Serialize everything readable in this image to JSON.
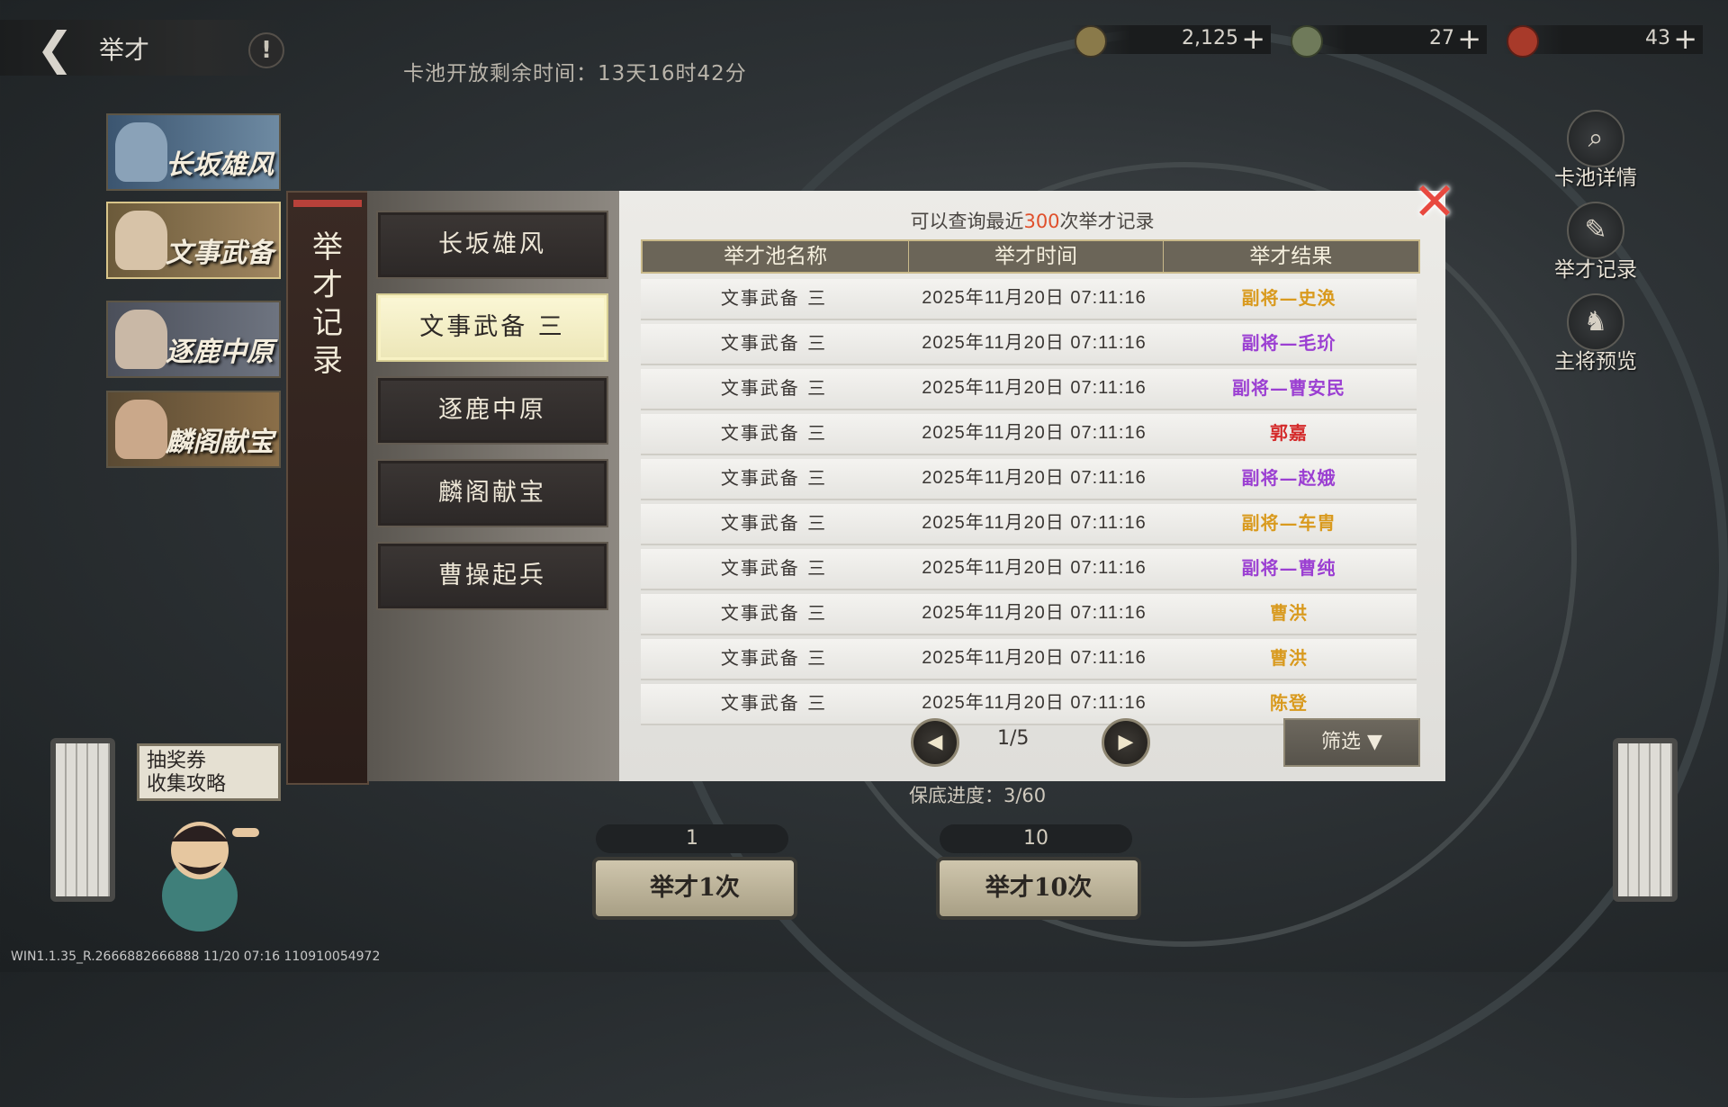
{
  "header": {
    "back_title": "举才",
    "info_label": "!",
    "pool_timer": "卡池开放剩余时间：13天16时42分"
  },
  "resources": [
    {
      "icon": "copper-coin-icon",
      "value": "2,125",
      "plus": "+",
      "color": "#8a7a4a"
    },
    {
      "icon": "jade-token-icon",
      "value": "27",
      "plus": "+",
      "color": "#6f7a5a"
    },
    {
      "icon": "red-gem-icon",
      "value": "43",
      "plus": "+",
      "color": "#a83a2a"
    }
  ],
  "banners": [
    {
      "label": "长坂雄风",
      "bg": "#3b5570",
      "face": "#8aa2b8"
    },
    {
      "label": "文事武备",
      "bg": "#6b5a3a",
      "face": "#d7c3a8"
    },
    {
      "label": "逐鹿中原",
      "bg": "#4b4f5a",
      "face": "#c9b8a6"
    },
    {
      "label": "麟阁献宝",
      "bg": "#5a4a33",
      "face": "#caa88a"
    }
  ],
  "side_menu": [
    {
      "label": "卡池详情",
      "icon": "magnifier-icon",
      "glyph": "⌕"
    },
    {
      "label": "举才记录",
      "icon": "brush-icon",
      "glyph": "✎"
    },
    {
      "label": "主将预览",
      "icon": "general-preview-icon",
      "glyph": "♞"
    }
  ],
  "guide": {
    "line1": "抽奖券",
    "line2": "收集攻略"
  },
  "modal": {
    "tab_label": "举才记录",
    "pools": [
      "长坂雄风",
      "文事武备 三",
      "逐鹿中原",
      "麟阁献宝",
      "曹操起兵"
    ],
    "active_pool_index": 1,
    "notice_prefix": "可以查询最近",
    "notice_count": "300",
    "notice_suffix": "次举才记录",
    "columns": [
      "举才池名称",
      "举才时间",
      "举才结果"
    ],
    "rows": [
      {
        "pool": "文事武备 三",
        "time": "2025年11月20日 07:11:16",
        "result": "副将—史涣",
        "color": "#d99a1e"
      },
      {
        "pool": "文事武备 三",
        "time": "2025年11月20日 07:11:16",
        "result": "副将—毛玠",
        "color": "#9b3fd2"
      },
      {
        "pool": "文事武备 三",
        "time": "2025年11月20日 07:11:16",
        "result": "副将—曹安民",
        "color": "#9b3fd2"
      },
      {
        "pool": "文事武备 三",
        "time": "2025年11月20日 07:11:16",
        "result": "郭嘉",
        "color": "#d42a2a"
      },
      {
        "pool": "文事武备 三",
        "time": "2025年11月20日 07:11:16",
        "result": "副将—赵娥",
        "color": "#9b3fd2"
      },
      {
        "pool": "文事武备 三",
        "time": "2025年11月20日 07:11:16",
        "result": "副将—车胄",
        "color": "#d99a1e"
      },
      {
        "pool": "文事武备 三",
        "time": "2025年11月20日 07:11:16",
        "result": "副将—曹纯",
        "color": "#9b3fd2"
      },
      {
        "pool": "文事武备 三",
        "time": "2025年11月20日 07:11:16",
        "result": "曹洪",
        "color": "#d99a1e"
      },
      {
        "pool": "文事武备 三",
        "time": "2025年11月20日 07:11:16",
        "result": "曹洪",
        "color": "#d99a1e"
      },
      {
        "pool": "文事武备 三",
        "time": "2025年11月20日 07:11:16",
        "result": "陈登",
        "color": "#d99a1e"
      }
    ],
    "page": "1/5",
    "filter_label": "筛选"
  },
  "bottom": {
    "pity": "保底进度：3/60",
    "single_cost": "1",
    "single_label": "举才1次",
    "ten_cost": "10",
    "ten_label": "举才10次"
  },
  "version": "WIN1.1.35_R.2666882666888 11/20 07:16 110910054972"
}
